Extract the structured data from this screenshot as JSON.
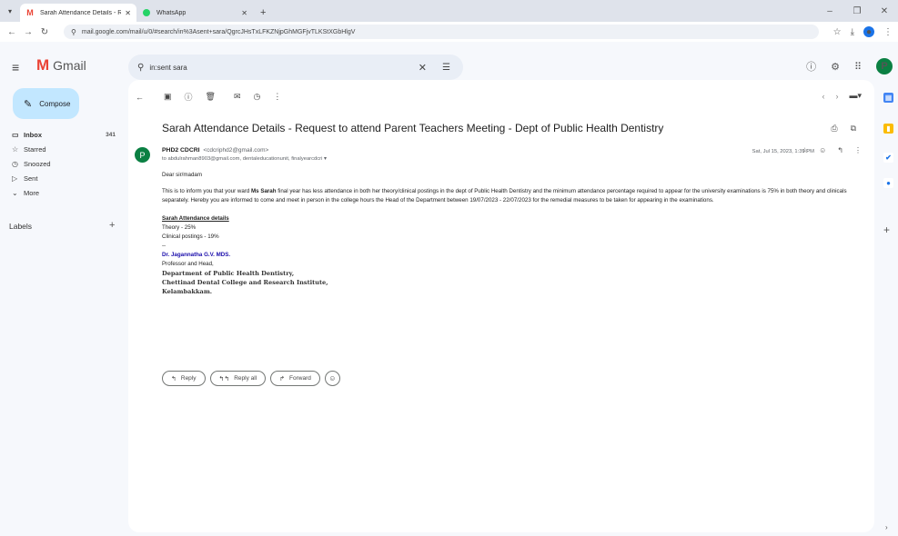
{
  "browser": {
    "tabs": [
      {
        "title": "Sarah Attendance Details - Req",
        "favicon": "gmail-icon",
        "active": true
      },
      {
        "title": "WhatsApp",
        "favicon": "whatsapp-icon",
        "active": false
      }
    ],
    "new_tab": "+",
    "url": "mail.google.com/mail/u/0/#search/in%3Asent+sara/QgrcJHsTxLFKZNjpGhMGFjvTLKStXGbHlgV"
  },
  "gmail": {
    "logo_text": "Gmail",
    "search_value": "in:sent sara",
    "compose_label": "Compose",
    "nav": [
      {
        "label": "Inbox",
        "count": "341",
        "icon": "inbox-icon",
        "bold": true
      },
      {
        "label": "Starred",
        "count": "",
        "icon": "star-icon",
        "bold": false
      },
      {
        "label": "Snoozed",
        "count": "",
        "icon": "clock-icon",
        "bold": false
      },
      {
        "label": "Sent",
        "count": "",
        "icon": "send-icon",
        "bold": false
      },
      {
        "label": "More",
        "count": "",
        "icon": "chevron-down-icon",
        "bold": false
      }
    ],
    "labels_heading": "Labels",
    "avatar_letter": "P"
  },
  "email": {
    "subject": "Sarah Attendance Details - Request to attend Parent Teachers Meeting - Dept of Public Health Dentistry",
    "sender_initial": "P",
    "sender_name": "PHD2 CDCRI",
    "sender_email": "<cdcriphd2@gmail.com>",
    "to": "to abdulrahman8903@gmail.com, dentaleducationunit, finalyearcdcri ▾",
    "date": "Sat, Jul 15, 2023, 1:39 PM",
    "greeting": "Dear sir/madam",
    "para_before": "This is to inform you that your ward ",
    "para_ward": "Ms Sarah",
    "para_after": " final year has less attendance in both her theory/clinical postings in the dept of Public Health Dentistry and the minimum attendance percentage required to appear for the university examinations is 75% in both theory and clinicals separately. Hereby you are informed to come and meet in person in the college hours the Head of the Department between 19/07/2023 - 22/07/2023 for the remedial measures to be taken for appearing in the examinations.",
    "attendance_heading": "Sarah Attendance details",
    "theory": "Theory - 25%",
    "clinical": "Clinical postings - 19%",
    "sig_sep": "--",
    "sig_name": "Dr. Jagannatha G.V. MDS.",
    "sig_title": "Professor and Head,",
    "sig_dept": "Department of Public Health Dentistry,",
    "sig_college": "Chettinad Dental College and Research Institute,",
    "sig_place": "Kelambakkam.",
    "actions": {
      "reply": "Reply",
      "reply_all": "Reply all",
      "forward": "Forward"
    }
  },
  "colors": {
    "compose_bg": "#c2e7ff",
    "app_bg": "#f6f8fc",
    "accent": "#1a73e8"
  }
}
